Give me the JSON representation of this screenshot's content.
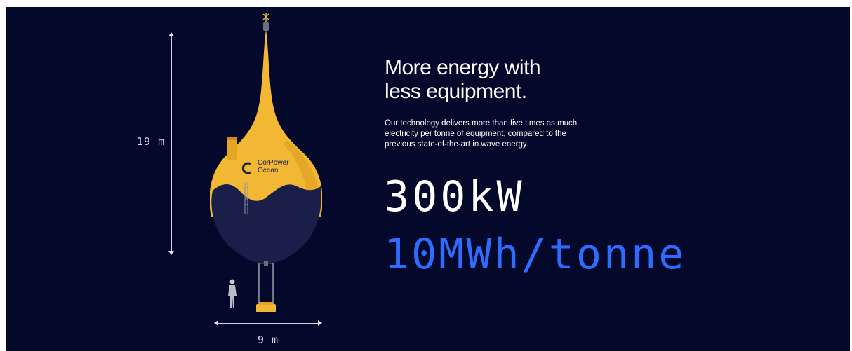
{
  "dimensions": {
    "height_label": "19 m",
    "width_label": "9 m"
  },
  "buoy": {
    "brand_line1": "CorPower",
    "brand_line2": "Ocean",
    "trademark": "™"
  },
  "copy": {
    "headline_line1": "More energy with",
    "headline_line2": "less equipment.",
    "body_line1": "Our technology delivers more than five times as much",
    "body_line2": "electricity per tonne of equipment, compared to the",
    "body_line3": "previous state-of-the-art in wave energy."
  },
  "stats": {
    "power": "300kW",
    "energy_per_tonne": "10MWh/tonne"
  },
  "colors": {
    "background": "#04082a",
    "buoy_yellow": "#f2b733",
    "buoy_navy": "#1a1f4a",
    "accent_blue": "#2f6bff",
    "text_white": "#ffffff"
  },
  "icons": {
    "height_arrow": "vertical-double-arrow",
    "width_arrow": "horizontal-double-arrow",
    "scale_figure": "human-silhouette"
  }
}
